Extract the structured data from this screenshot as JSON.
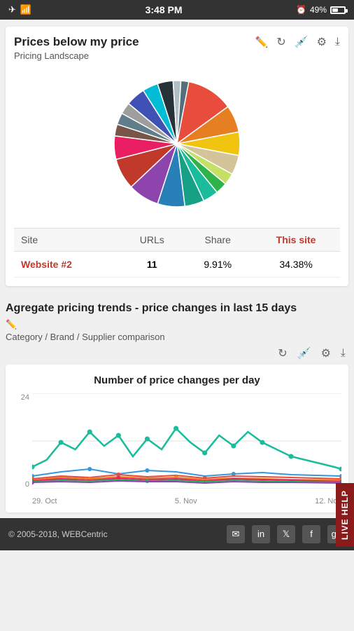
{
  "statusBar": {
    "time": "3:48 PM",
    "battery": "49%"
  },
  "card1": {
    "title": "Prices below my price",
    "subtitle": "Pricing Landscape",
    "table": {
      "headers": [
        "Site",
        "URLs",
        "Share",
        "This site"
      ],
      "rows": [
        {
          "site": "Website #2",
          "urls": "11",
          "share": "9.91%",
          "thisSite": "34.38%"
        }
      ]
    },
    "icons": [
      "refresh",
      "eyedropper",
      "gear",
      "download"
    ]
  },
  "section2": {
    "title": "Agregate pricing trends - price changes in last 15 days",
    "subtitle": "Category / Brand / Supplier comparison",
    "icons": [
      "refresh",
      "eyedropper",
      "gear",
      "download"
    ]
  },
  "chart": {
    "title": "Number of price changes per day",
    "yLabels": [
      "24",
      "0"
    ],
    "xLabels": [
      "29. Oct",
      "5. Nov",
      "12. Nov"
    ]
  },
  "footer": {
    "copyright": "© 2005-2018, WEBCentric",
    "socialIcons": [
      "email",
      "linkedin",
      "twitter",
      "facebook",
      "googleplus"
    ]
  },
  "liveHelp": {
    "label": "LIVE HELP"
  },
  "pieChart": {
    "segments": [
      {
        "color": "#e74c3c",
        "startAngle": 0,
        "endAngle": 55
      },
      {
        "color": "#e67e22",
        "startAngle": 55,
        "endAngle": 80
      },
      {
        "color": "#f1c40f",
        "startAngle": 80,
        "endAngle": 102
      },
      {
        "color": "#d4c49a",
        "startAngle": 102,
        "endAngle": 122
      },
      {
        "color": "#c0d88a",
        "startAngle": 122,
        "endAngle": 135
      },
      {
        "color": "#27ae60",
        "startAngle": 135,
        "endAngle": 148
      },
      {
        "color": "#1abc9c",
        "startAngle": 148,
        "endAngle": 165
      },
      {
        "color": "#16a085",
        "startAngle": 165,
        "endAngle": 185
      },
      {
        "color": "#2980b9",
        "startAngle": 185,
        "endAngle": 210
      },
      {
        "color": "#8e44ad",
        "startAngle": 210,
        "endAngle": 240
      },
      {
        "color": "#c0392b",
        "startAngle": 240,
        "endAngle": 270
      },
      {
        "color": "#e91e63",
        "startAngle": 270,
        "endAngle": 292
      },
      {
        "color": "#795548",
        "startAngle": 292,
        "endAngle": 305
      },
      {
        "color": "#607d8b",
        "startAngle": 305,
        "endAngle": 315
      },
      {
        "color": "#9e9e9e",
        "startAngle": 315,
        "endAngle": 328
      },
      {
        "color": "#3f51b5",
        "startAngle": 328,
        "endAngle": 345
      },
      {
        "color": "#00bcd4",
        "startAngle": 345,
        "endAngle": 360
      }
    ]
  }
}
